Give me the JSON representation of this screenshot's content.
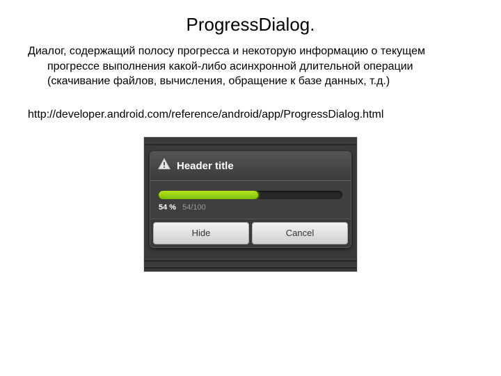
{
  "title": "ProgressDialog.",
  "description": "Диалог, содержащий полосу прогресса и некоторую информацию о текущем прогрессе выполнения какой-либо асинхронной длительной операции (скачивание файлов, вычисления, обращение к базе данных, т.д.)",
  "link": "http://developer.android.com/reference/android/app/ProgressDialog.html",
  "dialog": {
    "header": "Header title",
    "percent_label": "54 %",
    "fraction_label": "54/100",
    "percent_value": 54,
    "buttons": {
      "hide": "Hide",
      "cancel": "Cancel"
    }
  }
}
